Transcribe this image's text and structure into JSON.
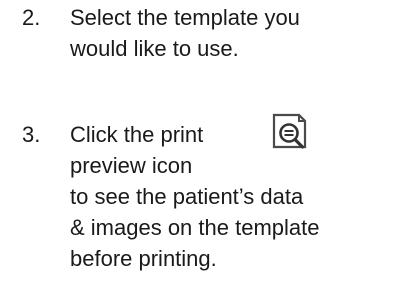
{
  "steps": [
    {
      "number": "2.",
      "lines": [
        "Select the template you",
        "would like to use."
      ]
    },
    {
      "number": "3.",
      "lines": [
        "Click the print",
        "preview icon",
        "to see the patient’s data",
        "& images on the template",
        "before printing."
      ],
      "icon": "print-preview-icon"
    }
  ]
}
